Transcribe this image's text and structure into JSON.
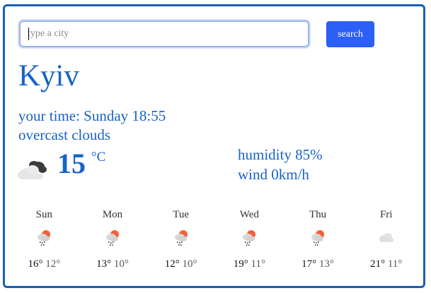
{
  "search": {
    "placeholder": "type a city",
    "button_label": "search"
  },
  "current": {
    "city": "Kyiv",
    "time": "your time: Sunday 18:55",
    "description": "overcast clouds",
    "temperature": "15",
    "unit": "°C",
    "humidity": "humidity 85%",
    "wind": "wind 0km/h",
    "icon": "overcast-clouds-icon"
  },
  "forecast": [
    {
      "day": "Sun",
      "max": "16°",
      "min": "12°",
      "icon": "rain-icon"
    },
    {
      "day": "Mon",
      "max": "13°",
      "min": "10°",
      "icon": "rain-icon"
    },
    {
      "day": "Tue",
      "max": "12°",
      "min": "10°",
      "icon": "rain-icon"
    },
    {
      "day": "Wed",
      "max": "19°",
      "min": "11°",
      "icon": "rain-icon"
    },
    {
      "day": "Thu",
      "max": "17°",
      "min": "13°",
      "icon": "rain-icon"
    },
    {
      "day": "Fri",
      "max": "21°",
      "min": "11°",
      "icon": "cloud-icon"
    }
  ],
  "colors": {
    "accent": "#1763c6",
    "button": "#2b5ff5",
    "border": "#1a5fb4",
    "sun": "#f2623a"
  }
}
